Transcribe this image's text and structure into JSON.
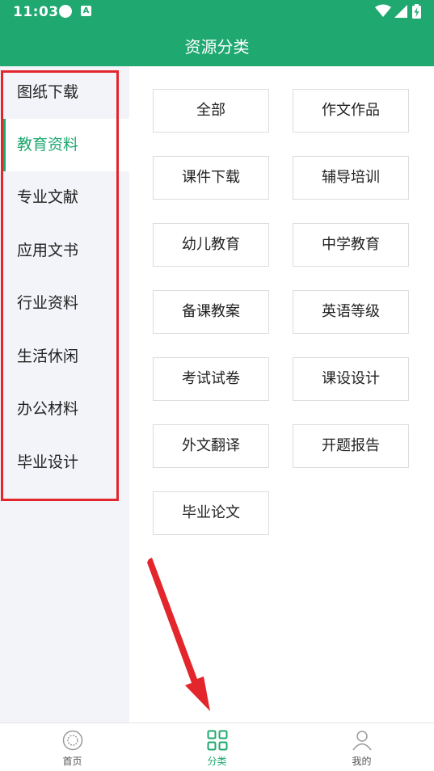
{
  "status": {
    "time": "11:03",
    "badge": "A"
  },
  "header": {
    "title": "资源分类"
  },
  "sidebar": {
    "active_index": 1,
    "items": [
      {
        "label": "图纸下载"
      },
      {
        "label": "教育资料"
      },
      {
        "label": "专业文献"
      },
      {
        "label": "应用文书"
      },
      {
        "label": "行业资料"
      },
      {
        "label": "生活休闲"
      },
      {
        "label": "办公材料"
      },
      {
        "label": "毕业设计"
      }
    ]
  },
  "categories": [
    {
      "label": "全部"
    },
    {
      "label": "作文作品"
    },
    {
      "label": "课件下载"
    },
    {
      "label": "辅导培训"
    },
    {
      "label": "幼儿教育"
    },
    {
      "label": "中学教育"
    },
    {
      "label": "备课教案"
    },
    {
      "label": "英语等级"
    },
    {
      "label": "考试试卷"
    },
    {
      "label": "课设设计"
    },
    {
      "label": "外文翻译"
    },
    {
      "label": "开题报告"
    },
    {
      "label": "毕业论文"
    }
  ],
  "bottom_nav": {
    "active_index": 1,
    "items": [
      {
        "label": "首页",
        "icon": "home-circle-icon"
      },
      {
        "label": "分类",
        "icon": "grid-icon"
      },
      {
        "label": "我的",
        "icon": "person-icon"
      }
    ]
  },
  "colors": {
    "brand": "#1fa870",
    "annotation": "#e3262b",
    "sidebar_bg": "#f3f4f9"
  }
}
